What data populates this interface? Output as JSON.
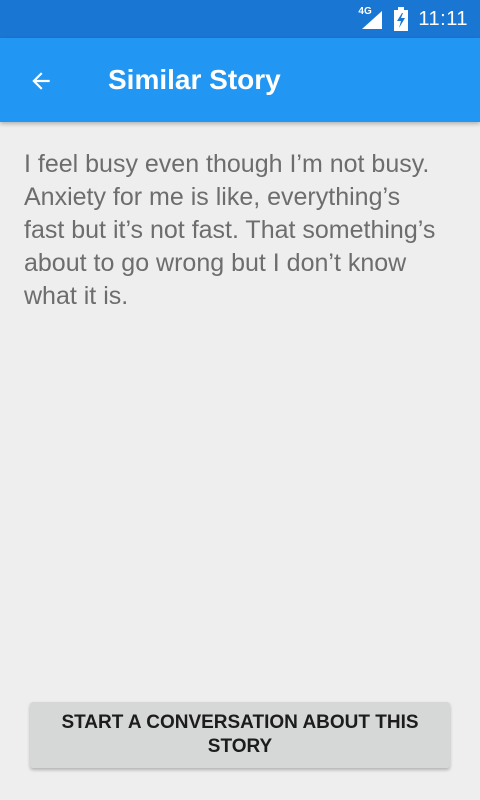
{
  "status_bar": {
    "network_type": "4G",
    "time": "11:11",
    "icons": [
      "signal-icon",
      "battery-charging-icon"
    ]
  },
  "app_bar": {
    "back_icon": "arrow-back-icon",
    "title": "Similar Story",
    "color": "#2196f3"
  },
  "story": {
    "text": "I feel busy even though I’m not busy. Anxiety for me is like, everything’s fast but it’s not fast. That something’s about to go wrong but I don’t know what it is."
  },
  "actions": {
    "start_conversation_label": "START A CONVERSATION ABOUT THIS STORY"
  }
}
